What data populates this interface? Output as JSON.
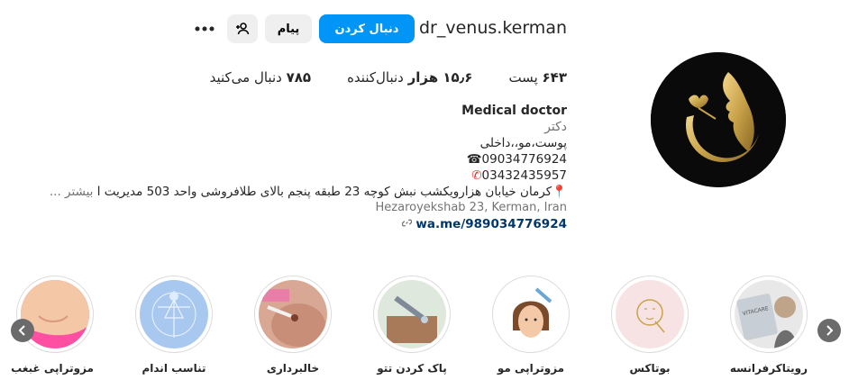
{
  "header": {
    "username": "dr_venus.kerman",
    "follow_label": "دنبال کردن",
    "message_label": "پیام"
  },
  "icons": {
    "suggest": "person-add-icon",
    "more": "more-options-icon",
    "phone": "telephone-icon",
    "phone2": "phone-receiver-icon",
    "pin": "location-pin-icon",
    "link": "link-icon"
  },
  "stats": {
    "posts": "۶۴۳",
    "posts_label": "پست",
    "followers": "۱۵٫۶ هزار",
    "followers_label": "دنبال‌کننده",
    "following": "۷۸۵",
    "following_label": "دنبال می‌کنید"
  },
  "bio": {
    "name": "Medical doctor",
    "category": "دکتر",
    "line1": "پوست،مو،،داخلی",
    "phone1": "09034776924",
    "phone2": "03432435957",
    "address": "کرمان خیابان هزارویکشب نبش کوچه 23 طبقه پنجم بالای طلافروشی واحد 503 مدیریت ا",
    "more": "بیشتر ...",
    "address_latin": "Hezaroyekshab 23, Kerman, Iran",
    "link": "wa.me/989034776924"
  },
  "highlights": [
    {
      "label": "رویتاکرفرانسه"
    },
    {
      "label": "بوتاکس"
    },
    {
      "label": "مزوتراپی مو"
    },
    {
      "label": "پاک کردن تتو"
    },
    {
      "label": "خالبرداری"
    },
    {
      "label": "تناسب اندام"
    },
    {
      "label": "مزوتراپی غبغب"
    }
  ],
  "colors": {
    "accent": "#0095f6",
    "gold": "#c9a24a",
    "link": "#00376b"
  }
}
